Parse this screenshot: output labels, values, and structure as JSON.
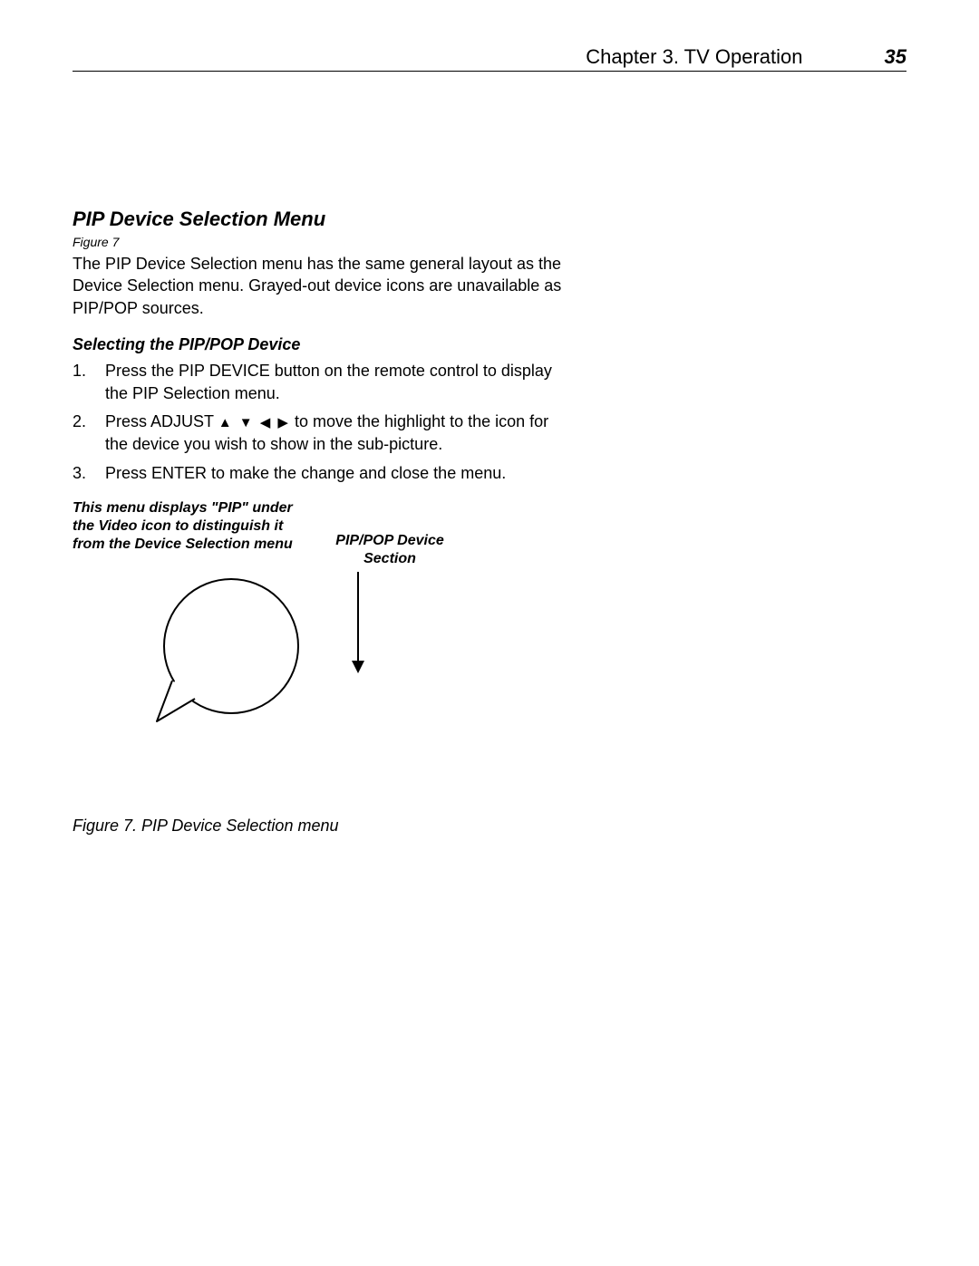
{
  "header": {
    "chapter": "Chapter 3. TV Operation",
    "page": "35"
  },
  "section": {
    "heading": "PIP Device Selection Menu",
    "figure_ref": "Figure 7",
    "intro": "The PIP Device Selection menu has the same general layout as the Device Selection menu.  Grayed-out device icons are unavailable as PIP/POP sources.",
    "sub_heading": "Selecting the PIP/POP Device",
    "steps": [
      {
        "pre": "Press the PIP DEVICE button on the remote control to display the PIP Selection menu."
      },
      {
        "pre": "Press ADJUST ",
        "arrows": "▲ ▼ ◀ ▶",
        "post": " to move the highlight to the icon for the device you wish to show in the sub-picture."
      },
      {
        "pre": "Press ENTER to make the change and close the menu."
      }
    ],
    "callout_left": "This menu displays \"PIP\" under the Video icon to distinguish it from the Device Selection menu",
    "callout_right": "PIP/POP Device Section",
    "figure_caption": "Figure 7.  PIP Device Selection menu"
  }
}
